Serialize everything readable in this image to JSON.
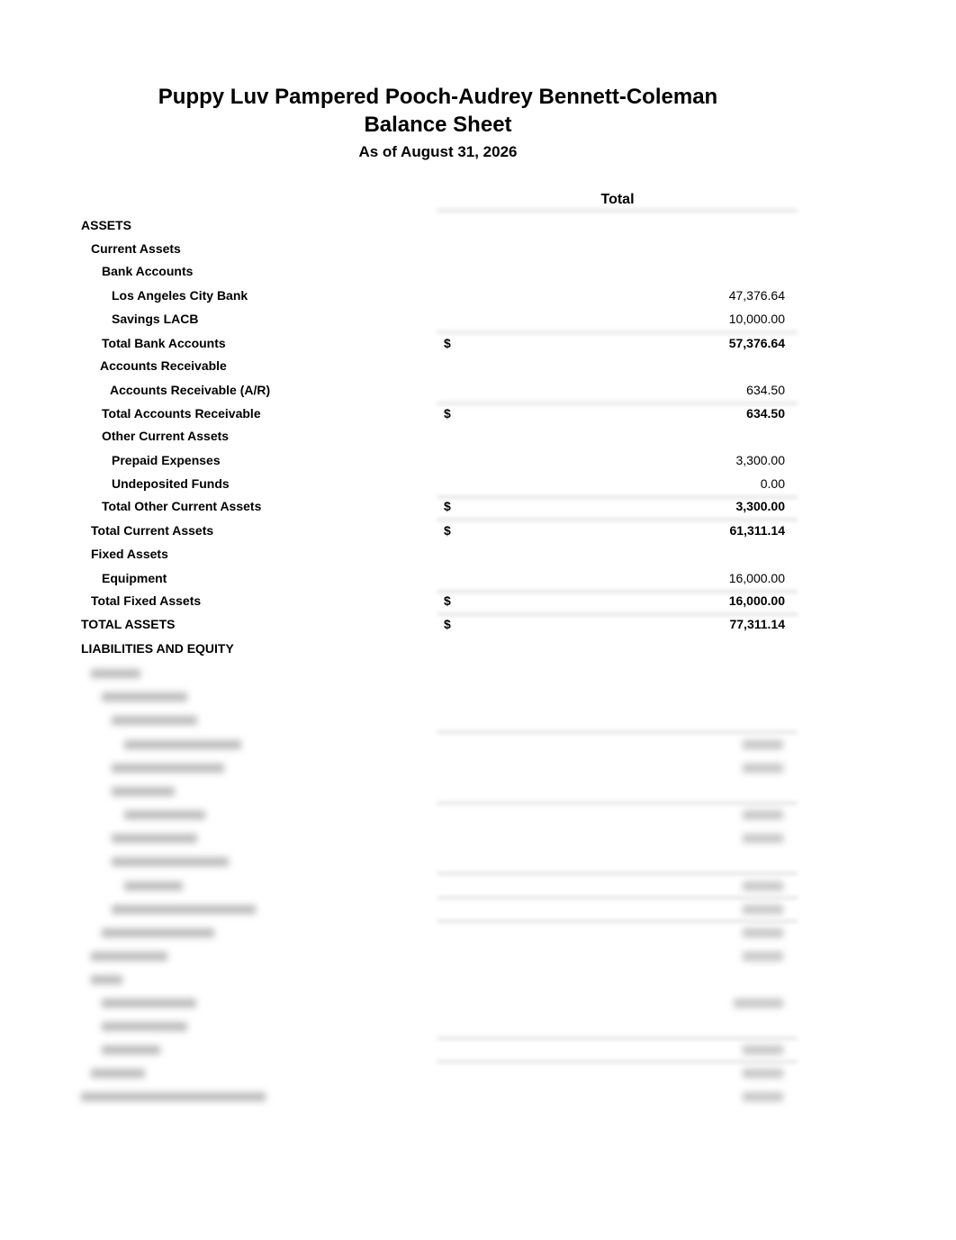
{
  "header": {
    "company": "Puppy Luv Pampered Pooch-Audrey Bennett-Coleman",
    "report_title": "Balance Sheet",
    "date_line": "As of August 31, 2026"
  },
  "column_header": "Total",
  "currency_symbol": "$",
  "rows": [
    {
      "label": "ASSETS",
      "indent": 0,
      "amount": "",
      "dollar": false,
      "bold": false
    },
    {
      "label": "Current Assets",
      "indent": 1,
      "amount": "",
      "dollar": false,
      "bold": false
    },
    {
      "label": "Bank Accounts",
      "indent": 2,
      "amount": "",
      "dollar": false,
      "bold": false
    },
    {
      "label": "Los Angeles City Bank",
      "indent": 3,
      "amount": "47,376.64",
      "dollar": false,
      "bold": false
    },
    {
      "label": "Savings LACB",
      "indent": 3,
      "amount": "10,000.00",
      "dollar": false,
      "bold": false
    },
    {
      "label": "Total Bank Accounts",
      "indent": 2,
      "amount": "57,376.64",
      "dollar": true,
      "bold": true
    },
    {
      "label": "Accounts Receivable",
      "indent": 2,
      "amount": "",
      "dollar": false,
      "bold": false
    },
    {
      "label": "Accounts Receivable (A/R)",
      "indent": 3,
      "amount": "634.50",
      "dollar": false,
      "bold": false
    },
    {
      "label": "Total Accounts Receivable",
      "indent": 2,
      "amount": "634.50",
      "dollar": true,
      "bold": true
    },
    {
      "label": "Other Current Assets",
      "indent": 2,
      "amount": "",
      "dollar": false,
      "bold": false
    },
    {
      "label": "Prepaid Expenses",
      "indent": 3,
      "amount": "3,300.00",
      "dollar": false,
      "bold": false
    },
    {
      "label": "Undeposited Funds",
      "indent": 3,
      "amount": "0.00",
      "dollar": false,
      "bold": false
    },
    {
      "label": "Total Other Current Assets",
      "indent": 2,
      "amount": "3,300.00",
      "dollar": true,
      "bold": true
    },
    {
      "label": "Total Current Assets",
      "indent": 1,
      "amount": "61,311.14",
      "dollar": true,
      "bold": true
    },
    {
      "label": "Fixed Assets",
      "indent": 1,
      "amount": "",
      "dollar": false,
      "bold": false
    },
    {
      "label": "Equipment",
      "indent": 2,
      "amount": "16,000.00",
      "dollar": false,
      "bold": false
    },
    {
      "label": "Total Fixed Assets",
      "indent": 1,
      "amount": "16,000.00",
      "dollar": true,
      "bold": true
    },
    {
      "label": "TOTAL ASSETS",
      "indent": 0,
      "amount": "77,311.14",
      "dollar": true,
      "bold": true
    },
    {
      "label": "LIABILITIES AND EQUITY",
      "indent": 0,
      "amount": "",
      "dollar": false,
      "bold": false
    }
  ],
  "blurred_section": {
    "note": "remaining rows are obscured (blurred) in the screenshot",
    "row_count": 19
  }
}
